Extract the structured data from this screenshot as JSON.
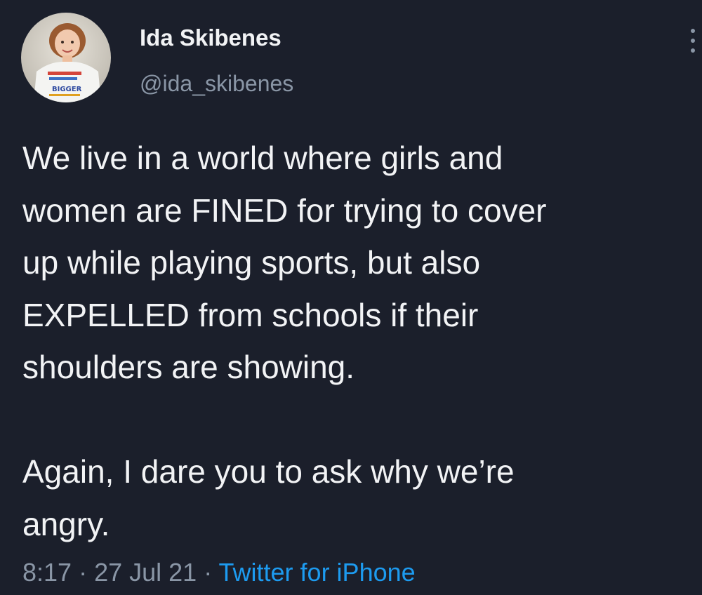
{
  "user": {
    "display_name": "Ida Skibenes",
    "handle": "@ida_skibenes",
    "avatar_icon": "profile-photo"
  },
  "tweet": {
    "paragraph_1": "We live in a world where girls and\nwomen are FINED for trying to cover\nup while playing sports, but also\nEXPELLED from schools if their\nshoulders are showing.",
    "paragraph_2": "Again, I dare you to ask why we’re\nangry.",
    "time": "8:17",
    "separator": " · ",
    "date": "27 Jul 21",
    "source": "Twitter for iPhone"
  },
  "menu": {
    "icon": "more-vertical-icon"
  },
  "colors": {
    "background": "#1b1f2b",
    "text": "#f2f3f5",
    "secondary": "#8a96a6",
    "link": "#1d9bf0"
  }
}
